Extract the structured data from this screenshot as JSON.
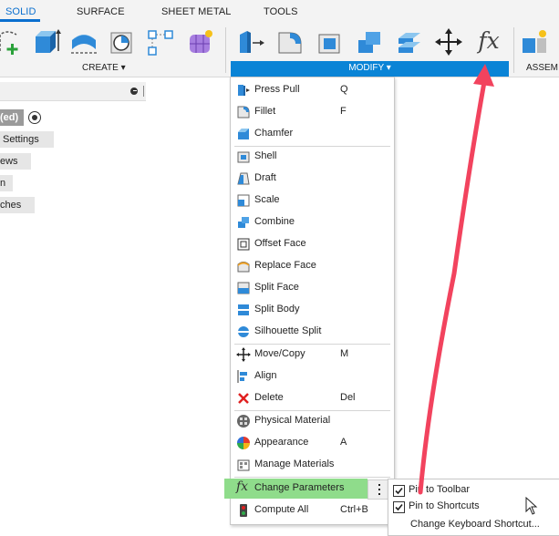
{
  "tabs": [
    "SOLID",
    "SURFACE",
    "SHEET METAL",
    "TOOLS"
  ],
  "active_tab": "SOLID",
  "toolbar": {
    "create_label": "CREATE ▾",
    "modify_label": "MODIFY ▾",
    "assemble_label": "ASSEM",
    "accent": "#0a84d6"
  },
  "browser": {
    "items": [
      "(ed)",
      "Settings",
      "ews",
      "n",
      "ches"
    ]
  },
  "menu": {
    "items": [
      {
        "label": "Press Pull",
        "key": "Q",
        "icon": "press-pull-icon"
      },
      {
        "label": "Fillet",
        "key": "F",
        "icon": "fillet-icon"
      },
      {
        "label": "Chamfer",
        "key": "",
        "icon": "chamfer-icon"
      },
      {
        "label": "Shell",
        "key": "",
        "icon": "shell-icon"
      },
      {
        "label": "Draft",
        "key": "",
        "icon": "draft-icon"
      },
      {
        "label": "Scale",
        "key": "",
        "icon": "scale-icon"
      },
      {
        "label": "Combine",
        "key": "",
        "icon": "combine-icon"
      },
      {
        "label": "Offset Face",
        "key": "",
        "icon": "offset-face-icon"
      },
      {
        "label": "Replace Face",
        "key": "",
        "icon": "replace-face-icon"
      },
      {
        "label": "Split Face",
        "key": "",
        "icon": "split-face-icon"
      },
      {
        "label": "Split Body",
        "key": "",
        "icon": "split-body-icon"
      },
      {
        "label": "Silhouette Split",
        "key": "",
        "icon": "silhouette-split-icon"
      },
      {
        "label": "Move/Copy",
        "key": "M",
        "icon": "move-icon"
      },
      {
        "label": "Align",
        "key": "",
        "icon": "align-icon"
      },
      {
        "label": "Delete",
        "key": "Del",
        "icon": "delete-icon"
      },
      {
        "label": "Physical Material",
        "key": "",
        "icon": "physical-material-icon"
      },
      {
        "label": "Appearance",
        "key": "A",
        "icon": "appearance-icon"
      },
      {
        "label": "Manage Materials",
        "key": "",
        "icon": "manage-materials-icon"
      },
      {
        "label": "Change Parameters",
        "key": "",
        "icon": "fx-icon"
      },
      {
        "label": "Compute All",
        "key": "Ctrl+B",
        "icon": "compute-all-icon"
      }
    ]
  },
  "submenu": {
    "items": [
      {
        "label": "Pin to Toolbar",
        "checked": true
      },
      {
        "label": "Pin to Shortcuts",
        "checked": true
      },
      {
        "label": "Change Keyboard Shortcut...",
        "checked": false
      }
    ]
  },
  "fx_symbol": "fx"
}
